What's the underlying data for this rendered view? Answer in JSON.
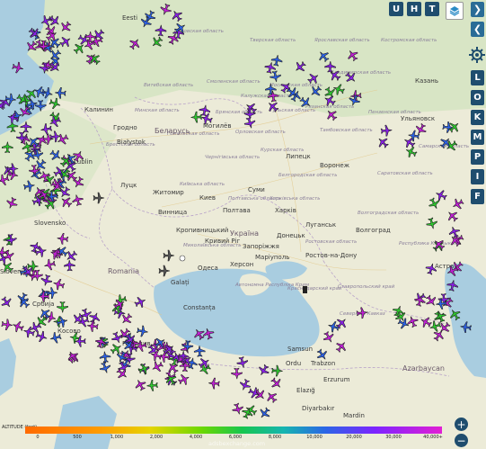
{
  "top_buttons": [
    "U",
    "H",
    "T"
  ],
  "side_buttons": [
    "L",
    "O",
    "K",
    "M",
    "P",
    "I",
    "F"
  ],
  "legend": {
    "title": "ALTITUDE (feet)",
    "ticks": [
      "0",
      "500",
      "1,000",
      "2,000",
      "4,000",
      "6,000",
      "8,000",
      "10,000",
      "20,000",
      "30,000",
      "40,000+"
    ]
  },
  "attribution": "adsbexchange.com",
  "labels": {
    "eesti": "Eesti",
    "kaliningrad": "Калинин",
    "grodno": "Гродно",
    "bialystok": "Białystok",
    "belarus": "Беларусь",
    "mogilev": "Могилёв",
    "lublin": "Lublin",
    "lutsk": "Луцк",
    "zhytomyr": "Житомир",
    "kiev": "Киев",
    "vinnytsia": "Винница",
    "ukraina": "Україна",
    "poltava": "Полтава",
    "sumy": "Суми",
    "kharkiv": "Харків",
    "kropyvnytskyi": "Кропивницький",
    "kryvyi_rih": "Кривий Ріг",
    "zaporizhzhia": "Запоріжжя",
    "donetsk": "Донецьк",
    "luhansk": "Луганськ",
    "rostov": "Ростов-на-Дону",
    "mariupol": "Маріуполь",
    "odesa": "Одеса",
    "kherson": "Херсон",
    "lipetsk": "Липецк",
    "voronezh": "Воронеж",
    "volgograd": "Волгоград",
    "kazan": "Казань",
    "ulyanovsk": "Ульяновск",
    "astrakhan": "Астра",
    "slovensko": "Slovensko",
    "slovenia": "Slovenia",
    "romania": "Romania",
    "srbija": "Србија",
    "constanta": "Constanța",
    "galati": "Galați",
    "kosovo": "Косово",
    "plovdiv": "Пловдив",
    "samsun": "Samsun",
    "ordu": "Ordu",
    "trabzon": "Trabzon",
    "erzurum": "Erzurum",
    "elazig": "Elazığ",
    "diyarbakir": "Diyarbakır",
    "mardin": "Mardin",
    "azerbaycan": "Azərbaycan",
    "srbija2": "Србија",
    "esli": "Eski",
    "pskov": "Псковская область",
    "tver": "Тверская область",
    "yaroslavl": "Ярославская область",
    "kostroma": "Костромская область",
    "vladimir": "Владимирская область",
    "moscow": "Московская область",
    "smolensk": "Смоленская область",
    "ryazan": "Рязанская область",
    "tula": "Тульская область",
    "kaluga": "Калужская область",
    "bryansk": "Брянская область",
    "orel": "Орловская область",
    "kursk": "Курская область",
    "belgorod": "Белгородская область",
    "tambov": "Тамбовская область",
    "penza": "Пензенская область",
    "saratov": "Саратовская область",
    "samara": "Самарская область",
    "volgograd_obl": "Волгоградская область",
    "rostov_obl": "Ростовская область",
    "krasnodar": "Краснодарский край",
    "stavropol": "Ставропольский край",
    "kalmykia": "Республика Калмыкия",
    "vitebsk": "Витебская область",
    "minsk": "Минская область",
    "brest": "Брестская область",
    "gomel": "Гомельская область",
    "chernihiv": "Чернігівська область",
    "kyiv_obl": "Київська область",
    "poltava_obl": "Полтавська область",
    "kharkiv_obl": "Харківська область",
    "mykolaiv": "Миколаївська область",
    "krym": "Автономна Республіка Крим",
    "severnyi_kavkaz": "Северный Кавказ"
  },
  "colors": {
    "land": "#ecebd8",
    "land_green": "#cfe3bb",
    "sea": "#a9cde0",
    "plane_purple": "#8a1fe8",
    "plane_magenta": "#c21fd6",
    "plane_blue": "#2c62e8",
    "plane_green": "#2ec82e"
  }
}
